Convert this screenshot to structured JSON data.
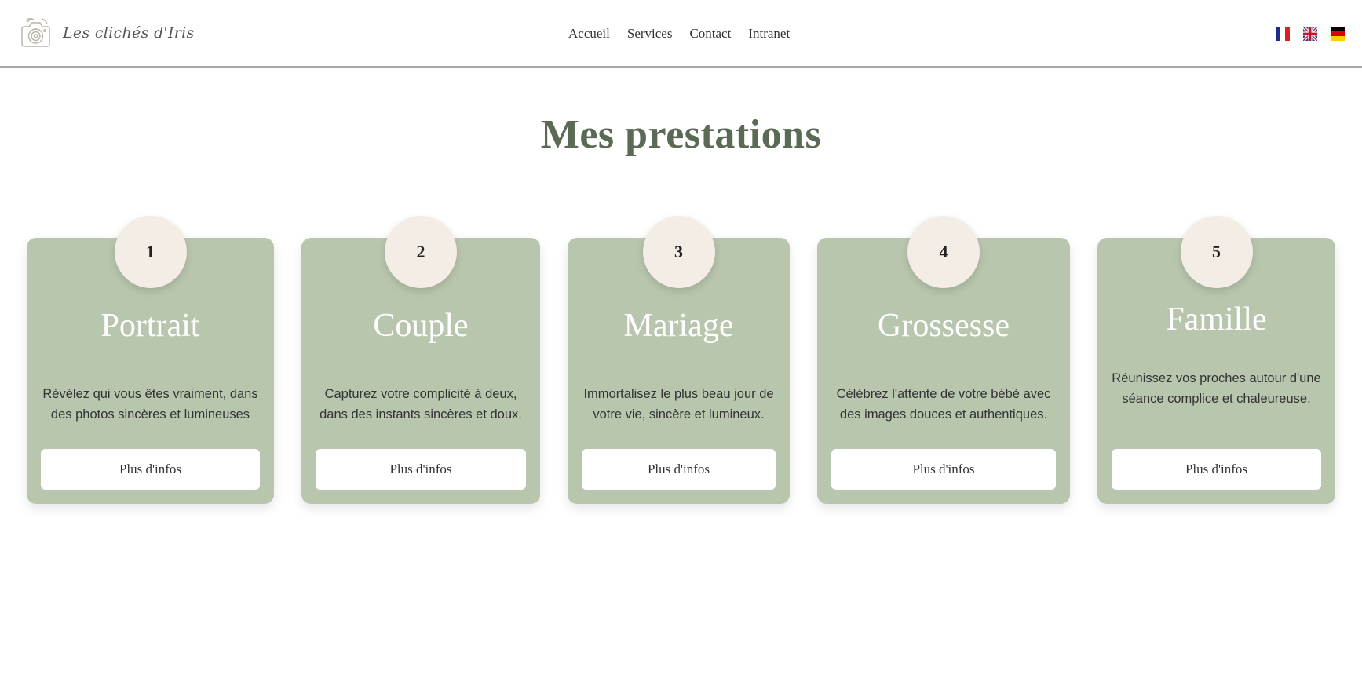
{
  "header": {
    "logo_text": "Les clichés d'Iris",
    "nav": [
      {
        "label": "Accueil"
      },
      {
        "label": "Services"
      },
      {
        "label": "Contact"
      },
      {
        "label": "Intranet"
      }
    ],
    "languages": [
      {
        "code": "fr",
        "icon": "french-flag-icon"
      },
      {
        "code": "en",
        "icon": "uk-flag-icon"
      },
      {
        "code": "de",
        "icon": "german-flag-icon"
      }
    ]
  },
  "main": {
    "title": "Mes prestations",
    "services": [
      {
        "number": "1",
        "title": "Portrait",
        "description": "Révélez qui vous êtes vraiment, dans des photos sincères et lumineuses",
        "button": "Plus d'infos"
      },
      {
        "number": "2",
        "title": "Couple",
        "description": "Capturez votre complicité à deux, dans des instants sincères et doux.",
        "button": "Plus d'infos"
      },
      {
        "number": "3",
        "title": "Mariage",
        "description": "Immortalisez le plus beau jour de votre vie, sincère et lumineux.",
        "button": "Plus d'infos"
      },
      {
        "number": "4",
        "title": "Grossesse",
        "description": "Célébrez l'attente de votre bébé avec des images douces et authentiques.",
        "button": "Plus d'infos"
      },
      {
        "number": "5",
        "title": "Famille",
        "description": "Réunissez vos proches autour d'une séance complice et chaleureuse.",
        "button": "Plus d'infos"
      }
    ]
  },
  "colors": {
    "card_background": "#b9c6ae",
    "badge_background": "#f3ede6",
    "title_color": "#5a6a55",
    "divider": "#a8a8a8"
  }
}
